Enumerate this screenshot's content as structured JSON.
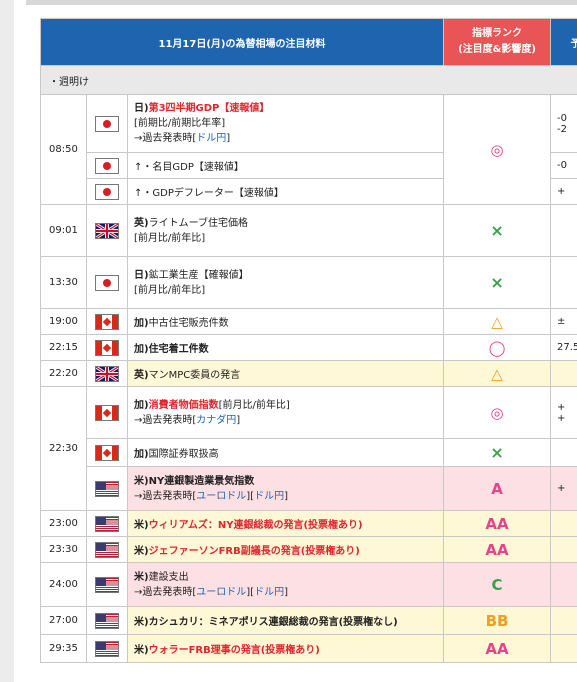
{
  "header": {
    "title": "11月17日(月)の為替相場の注目材料",
    "rank_line1": "指標ランク",
    "rank_line2": "(注目度&影響度)",
    "col3_label": "予"
  },
  "sections": {
    "open": "・週明け"
  },
  "times": {
    "t0850": "08:50",
    "t0901": "09:01",
    "t1330": "13:30",
    "t1900": "19:00",
    "t2215": "22:15",
    "t2220": "22:20",
    "t2230": "22:30",
    "t2300": "23:00",
    "t2330": "23:30",
    "t2400": "24:00",
    "t2700": "27:00",
    "t2935": "29:35"
  },
  "events": {
    "jp_gdp": {
      "prefix": "日)",
      "name": "第3四半期GDP【速報値】",
      "sub": "[前期比/前期比年率]",
      "arrow": "→過去発表時[",
      "link": "ドル円",
      "close": "]",
      "forecast1": "-0",
      "forecast2": "-2"
    },
    "jp_nominal": {
      "text": "↑・名目GDP【速報値】",
      "forecast": "-0"
    },
    "jp_deflator": {
      "text": "↑・GDPデフレーター【速報値】",
      "forecast": "+"
    },
    "uk_rightmove": {
      "prefix": "英)",
      "name": "ライトムーブ住宅価格",
      "sub": "[前月比/前年比]"
    },
    "jp_mining": {
      "prefix": "日)",
      "name": "鉱工業生産【確報値】",
      "sub": "[前月比/前年比]"
    },
    "ca_resale": {
      "prefix": "加)",
      "name": "中古住宅販売件数",
      "forecast": "±"
    },
    "ca_starts": {
      "prefix": "加)",
      "name": "住宅着工件数",
      "forecast": "27.5"
    },
    "uk_mpc": {
      "prefix": "英)",
      "name": "マンMPC委員の発言"
    },
    "ca_cpi": {
      "prefix": "加)",
      "name": "消費者物価指数",
      "bracket": "[前月比/前年比]",
      "arrow": "→過去発表時[",
      "link": "カナダ円",
      "close": "]",
      "forecast1": "+",
      "forecast2": "+"
    },
    "ca_sec": {
      "prefix": "加)",
      "name": "国際証券取扱高"
    },
    "us_ny": {
      "prefix": "米)",
      "name": "NY連銀製造業景気指数",
      "arrow": "→過去発表時[",
      "link1": "ユーロドル",
      "link2": "ドル円",
      "close": "]",
      "forecast": "+"
    },
    "us_williams": {
      "prefix": "米)",
      "name": "ウィリアムズ：NY連銀総裁の発言(投票権あり)"
    },
    "us_jefferson": {
      "prefix": "米)",
      "name": "ジェファーソンFRB副議長の発言(投票権あり)"
    },
    "us_construction": {
      "prefix": "米)",
      "name": "建設支出",
      "arrow": "→過去発表時[",
      "link1": "ユーロドル",
      "link2": "ドル円",
      "close": "]"
    },
    "us_kashkari": {
      "prefix": "米)",
      "name": "カシュカリ：ミネアポリス連銀総裁の発言(投票権なし)"
    },
    "us_waller": {
      "prefix": "米)",
      "name": "ウォラーFRB理事の発言(投票権あり)"
    }
  },
  "ranks": {
    "double_circle": "◎",
    "cross": "×",
    "triangle": "△",
    "circle": "◯",
    "A": "A",
    "AA": "AA",
    "C": "C",
    "BB": "BB"
  },
  "colors": {
    "header_blue": "#1f64ae",
    "rank_red": "#e95456",
    "row_pink": "#fde0e4",
    "row_yellow": "#fff8d6"
  }
}
